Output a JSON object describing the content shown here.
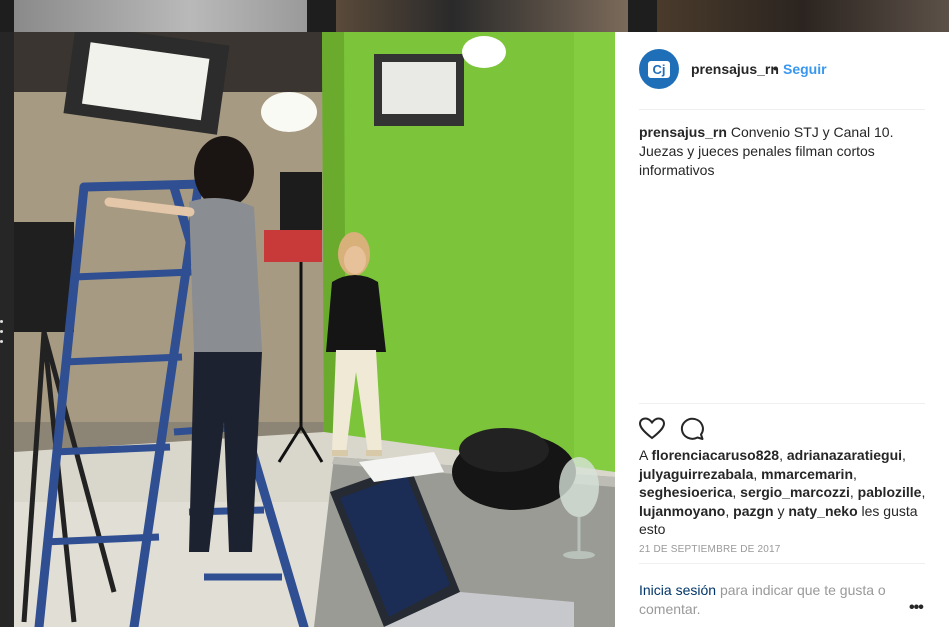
{
  "post": {
    "username": "prensajus_rn",
    "avatar_text": "Cj",
    "separator": "•",
    "follow_label": "Seguir",
    "caption_user": "prensajus_rn",
    "caption_text": "Convenio STJ y Canal 10. Juezas y jueces penales filman cortos informativos",
    "likers": [
      "florenciacaruso828",
      "adrianazaratiegui",
      "julyaguirrezabala",
      "mmarcemarin",
      "seghesioerica",
      "sergio_marcozzi",
      "pablozille",
      "lujanmoyano",
      "pazgn",
      "naty_neko"
    ],
    "likes_prefix": "A",
    "likes_and": "y",
    "likes_suffix": "les gusta esto",
    "date": "21 DE SEPTIEMBRE DE 2017",
    "login_link": "Inicia sesión",
    "login_rest": "para indicar que te gusta o comentar.",
    "more_label": "•••"
  },
  "icons": {
    "like": "heart-icon",
    "comment": "comment-icon"
  },
  "colors": {
    "link_blue": "#3897f0",
    "text": "#262626",
    "muted": "#999999",
    "greenscreen": "#7cc43a"
  }
}
